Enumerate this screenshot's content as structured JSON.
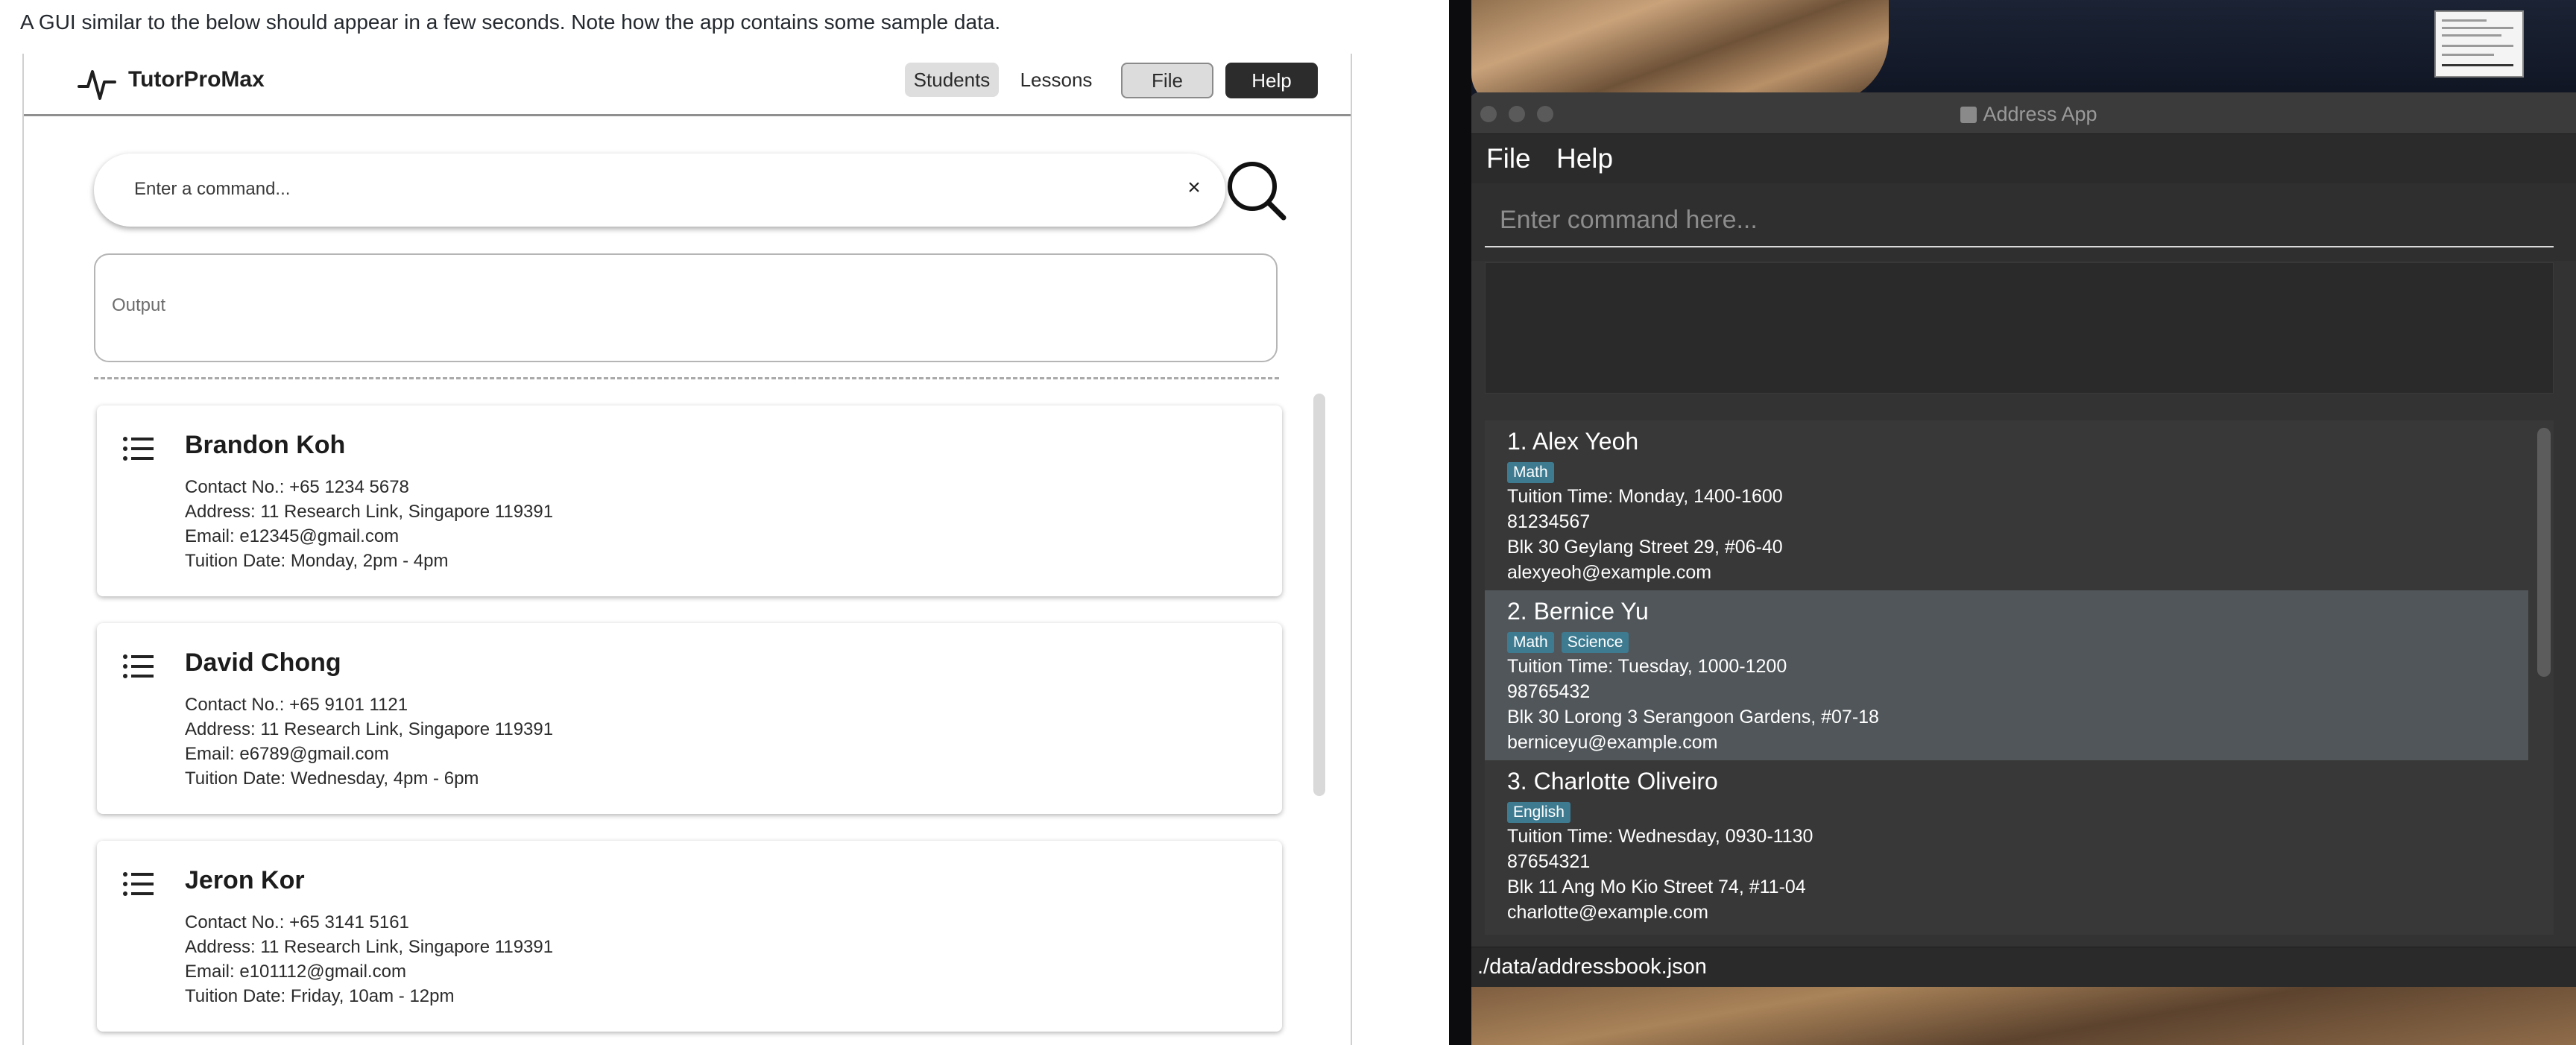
{
  "doc": {
    "note": "A GUI similar to the below should appear in a few seconds. Note how the app contains some sample data."
  },
  "tutorpromax": {
    "brand": "TutorProMax",
    "nav": {
      "students": "Students",
      "lessons": "Lessons",
      "file": "File",
      "help": "Help"
    },
    "command_placeholder": "Enter a command...",
    "clear_glyph": "×",
    "output_label": "Output",
    "students": [
      {
        "name": "Brandon Koh",
        "contact": "Contact No.: +65 1234 5678",
        "address": "Address: 11 Research Link, Singapore 119391",
        "email": "Email: e12345@gmail.com",
        "tuition": "Tuition Date: Monday, 2pm - 4pm"
      },
      {
        "name": "David Chong",
        "contact": "Contact No.: +65 9101 1121",
        "address": "Address: 11 Research Link, Singapore 119391",
        "email": "Email: e6789@gmail.com",
        "tuition": "Tuition Date: Wednesday, 4pm - 6pm"
      },
      {
        "name": "Jeron Kor",
        "contact": "Contact No.: +65 3141 5161",
        "address": "Address: 11 Research Link, Singapore 119391",
        "email": "Email: e101112@gmail.com",
        "tuition": "Tuition Date: Friday, 10am - 12pm"
      }
    ]
  },
  "address_app": {
    "title": "Address App",
    "menu": {
      "file": "File",
      "help": "Help"
    },
    "command_placeholder": "Enter command here...",
    "persons": [
      {
        "name": "1. Alex Yeoh",
        "tags": [
          "Math"
        ],
        "tuition": "Tuition Time: Monday, 1400-1600",
        "phone": "81234567",
        "address": "Blk 30 Geylang Street 29, #06-40",
        "email": "alexyeoh@example.com"
      },
      {
        "name": "2. Bernice Yu",
        "tags": [
          "Math",
          "Science"
        ],
        "tuition": "Tuition Time: Tuesday, 1000-1200",
        "phone": "98765432",
        "address": "Blk 30 Lorong 3 Serangoon Gardens, #07-18",
        "email": "berniceyu@example.com"
      },
      {
        "name": "3. Charlotte Oliveiro",
        "tags": [
          "English"
        ],
        "tuition": "Tuition Time: Wednesday, 0930-1130",
        "phone": "87654321",
        "address": "Blk 11 Ang Mo Kio Street 74, #11-04",
        "email": "charlotte@example.com"
      }
    ],
    "status_path": "./data/addressbook.json"
  },
  "colors": {
    "tag_background": "#3e7b91",
    "selected_row": "#505659",
    "help_button": "#2c2c2c"
  }
}
